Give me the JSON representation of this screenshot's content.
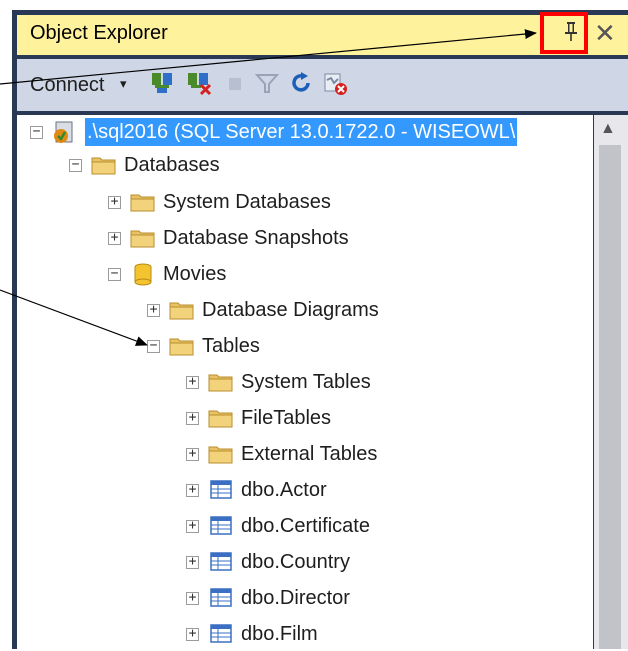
{
  "window": {
    "title": "Object Explorer",
    "pin_icon": "pin-icon",
    "close_icon": "close-icon",
    "pin_glyph": "ᅳ"
  },
  "toolbar": {
    "connect_label": "Connect",
    "caret": "▾",
    "icons": [
      "connect-object-explorer-icon",
      "disconnect-icon",
      "stop-icon",
      "filter-icon",
      "refresh-icon",
      "activity-monitor-icon"
    ]
  },
  "tree": [
    {
      "label": ".\\sql2016 (SQL Server 13.0.1722.0 - WISEOWL\\",
      "expander": "−",
      "icon": "server-icon",
      "selected": true
    },
    {
      "label": "Databases",
      "expander": "−",
      "icon": "folder-icon"
    },
    {
      "label": "System Databases",
      "expander": "+",
      "icon": "folder-icon"
    },
    {
      "label": "Database Snapshots",
      "expander": "+",
      "icon": "folder-icon"
    },
    {
      "label": "Movies",
      "expander": "−",
      "icon": "database-icon"
    },
    {
      "label": "Database Diagrams",
      "expander": "+",
      "icon": "folder-icon"
    },
    {
      "label": "Tables",
      "expander": "−",
      "icon": "folder-icon"
    },
    {
      "label": "System Tables",
      "expander": "+",
      "icon": "folder-icon"
    },
    {
      "label": "FileTables",
      "expander": "+",
      "icon": "folder-icon"
    },
    {
      "label": "External Tables",
      "expander": "+",
      "icon": "folder-icon"
    },
    {
      "label": "dbo.Actor",
      "expander": "+",
      "icon": "table-icon"
    },
    {
      "label": "dbo.Certificate",
      "expander": "+",
      "icon": "table-icon"
    },
    {
      "label": "dbo.Country",
      "expander": "+",
      "icon": "table-icon"
    },
    {
      "label": "dbo.Director",
      "expander": "+",
      "icon": "table-icon"
    },
    {
      "label": "dbo.Film",
      "expander": "+",
      "icon": "table-icon"
    }
  ],
  "scrollbar": {
    "up_glyph": "▲"
  },
  "colors": {
    "title_bar": "#fff29d",
    "toolbar": "#cfd6e5",
    "frame": "#293955",
    "selection": "#3399ff",
    "highlight": "#ff0000",
    "folder": "#e8c264"
  }
}
